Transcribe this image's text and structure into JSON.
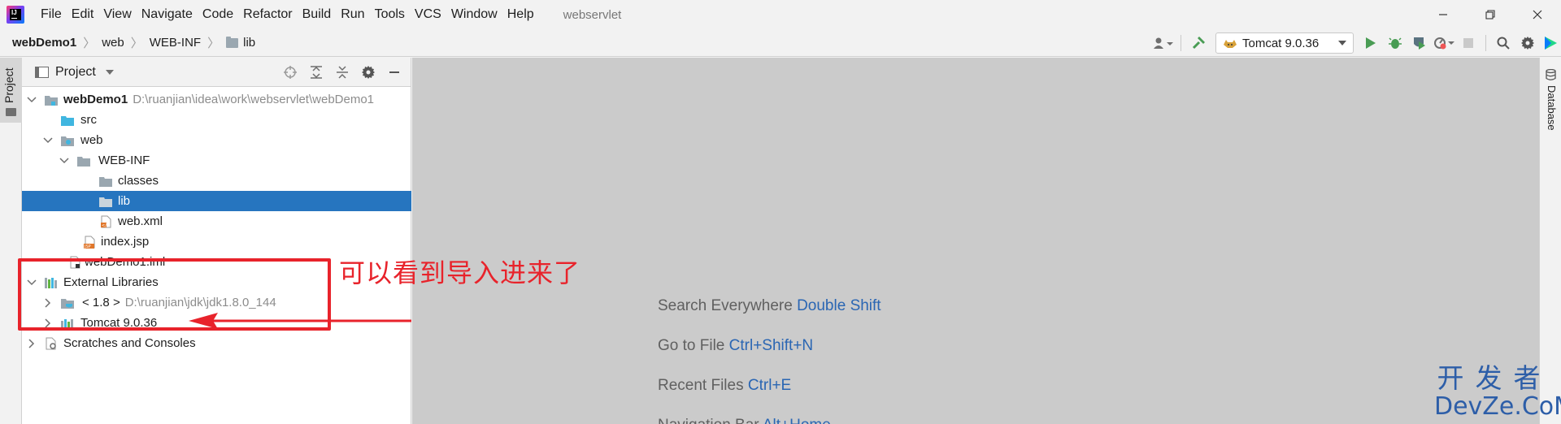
{
  "app": {
    "title": "webservlet",
    "menu": [
      "File",
      "Edit",
      "View",
      "Navigate",
      "Code",
      "Refactor",
      "Build",
      "Run",
      "Tools",
      "VCS",
      "Window",
      "Help"
    ]
  },
  "breadcrumb": [
    "webDemo1",
    "web",
    "WEB-INF",
    "lib"
  ],
  "toolbar": {
    "run_config": "Tomcat 9.0.36"
  },
  "left_strip": {
    "project_tab": "Project"
  },
  "right_strip": {
    "database_tab": "Database"
  },
  "project_panel": {
    "title": "Project",
    "tree": {
      "root_name": "webDemo1",
      "root_path": "D:\\ruanjian\\idea\\work\\webservlet\\webDemo1",
      "src": "src",
      "web": "web",
      "web_inf": "WEB-INF",
      "classes": "classes",
      "lib": "lib",
      "web_xml": "web.xml",
      "index_jsp": "index.jsp",
      "iml": "webDemo1.iml",
      "external_libraries": "External Libraries",
      "jdk_label": "< 1.8 >",
      "jdk_path": "D:\\ruanjian\\jdk\\jdk1.8.0_144",
      "tomcat": "Tomcat 9.0.36",
      "scratches": "Scratches and Consoles"
    }
  },
  "editor_hints": [
    {
      "label": "Search Everywhere",
      "key": "Double Shift"
    },
    {
      "label": "Go to File",
      "key": "Ctrl+Shift+N"
    },
    {
      "label": "Recent Files",
      "key": "Ctrl+E"
    },
    {
      "label": "Navigation Bar",
      "key": "Alt+Home"
    }
  ],
  "annotation": {
    "text": "可以看到导入进来了",
    "color": "#e8232b"
  },
  "watermark": {
    "line1": "开发者",
    "line2": "DevZe.CoM"
  },
  "colors": {
    "selection": "#2675bf",
    "accent_link": "#2a66b3",
    "editor_bg": "#cbcbcb"
  }
}
